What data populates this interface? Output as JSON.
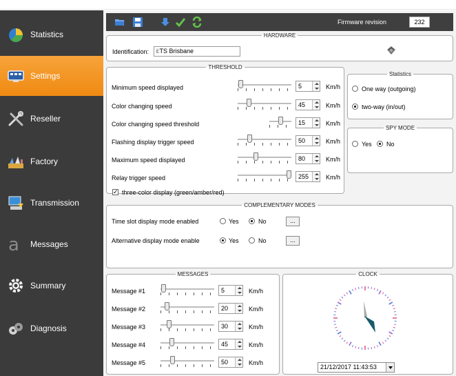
{
  "sidebar": {
    "items": [
      {
        "label": "Statistics",
        "icon": "chart-pie-icon"
      },
      {
        "label": "Settings",
        "icon": "monitor-settings-icon"
      },
      {
        "label": "Reseller",
        "icon": "tools-icon"
      },
      {
        "label": "Factory",
        "icon": "factory-icon"
      },
      {
        "label": "Transmission",
        "icon": "transmission-icon"
      },
      {
        "label": "Messages",
        "icon": "messages-icon"
      },
      {
        "label": "Summary",
        "icon": "gear-icon"
      },
      {
        "label": "Diagnosis",
        "icon": "diagnosis-icon"
      }
    ],
    "active": "Settings"
  },
  "toolbar": {
    "icons": [
      "folder-open-icon",
      "save-icon",
      "download-icon",
      "check-icon",
      "refresh-icon"
    ],
    "firmware_label": "Firmware revision",
    "firmware_value": "232"
  },
  "hardware": {
    "title": "HARDWARE",
    "identification_label": "Identification:",
    "identification_value": "i:TS Brisbane"
  },
  "threshold": {
    "title": "THRESHOLD",
    "rows": [
      {
        "label": "Minimum speed displayed",
        "value": "5",
        "unit": "Km/h",
        "level": 0.02
      },
      {
        "label": "Color changing speed",
        "value": "45",
        "unit": "Km/h",
        "level": 0.18
      },
      {
        "label": "Color changing speed threshold",
        "value": "15",
        "unit": "Km/h",
        "level": 0.5
      },
      {
        "label": "Flashing display trigger speed",
        "value": "50",
        "unit": "Km/h",
        "level": 0.2
      },
      {
        "label": "Maximum speed displayed",
        "value": "80",
        "unit": "Km/h",
        "level": 0.33
      },
      {
        "label": "Relay trigger speed",
        "value": "255",
        "unit": "Km/h",
        "level": 1.0
      }
    ],
    "three_color_label": "three-color display (green/amber/red)",
    "three_color_checked": true
  },
  "statistics": {
    "title": "Statistics",
    "option1": "One way (outgoing)",
    "option2": "two-way (in/out)",
    "selected": "two-way (in/out)"
  },
  "spy_mode": {
    "title": "SPY MODE",
    "yes": "Yes",
    "no": "No",
    "selected": "No"
  },
  "complementary": {
    "title": "COMPLEMENTARY MODES",
    "rows": [
      {
        "label": "Time slot display mode enabled",
        "yes": "Yes",
        "no": "No",
        "selected": "No",
        "button": "..."
      },
      {
        "label": "Alternative display mode enable",
        "yes": "Yes",
        "no": "No",
        "selected": "Yes",
        "button": "..."
      }
    ]
  },
  "messages": {
    "title": "MESSAGES",
    "rows": [
      {
        "label": "Message #1",
        "value": "5",
        "unit": "Km/h",
        "level": 0.02
      },
      {
        "label": "Message #2",
        "value": "20",
        "unit": "Km/h",
        "level": 0.08
      },
      {
        "label": "Message #3",
        "value": "30",
        "unit": "Km/h",
        "level": 0.12
      },
      {
        "label": "Message #4",
        "value": "45",
        "unit": "Km/h",
        "level": 0.18
      },
      {
        "label": "Message #5",
        "value": "50",
        "unit": "Km/h",
        "level": 0.2
      }
    ]
  },
  "clock": {
    "title": "CLOCK",
    "datetime": "21/12/2017 11:43:53"
  },
  "colors": {
    "sidebar_bg": "#3b3b3b",
    "active_item": "#f39a26",
    "toolbar_bg": "#3f3f3f",
    "clock_hand": "#1a5a6a"
  }
}
